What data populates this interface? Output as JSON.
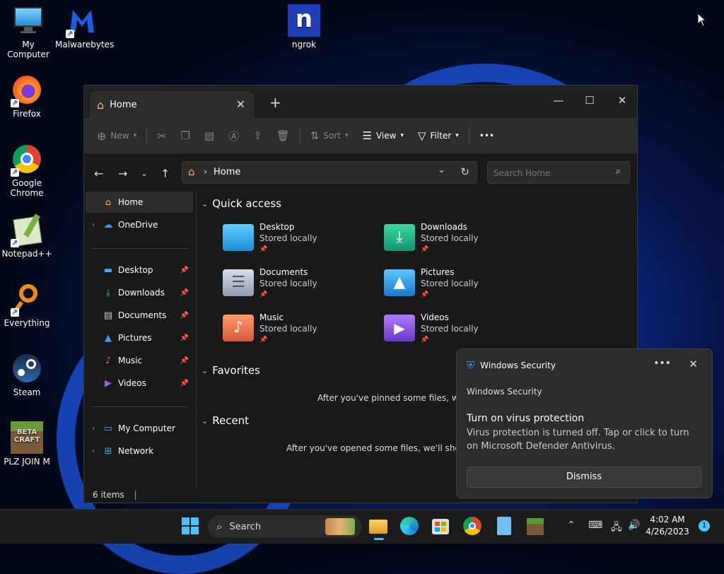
{
  "desktop": {
    "icons": [
      {
        "label": "My Computer",
        "icon": "monitor-icon"
      },
      {
        "label": "Malwarebytes",
        "icon": "malwarebytes-icon"
      },
      {
        "label": "ngrok",
        "icon": "ngrok-icon"
      },
      {
        "label": "Firefox",
        "icon": "firefox-icon"
      },
      {
        "label": "Google Chrome",
        "icon": "chrome-icon"
      },
      {
        "label": "Notepad++",
        "icon": "notepadpp-icon"
      },
      {
        "label": "Everything",
        "icon": "everything-icon"
      },
      {
        "label": "Steam",
        "icon": "steam-icon"
      },
      {
        "label": "PLZ JOIN M",
        "icon": "betacraft-icon"
      }
    ],
    "ngrok_glyph": "n",
    "betacraft_text": "BETA CRAFT"
  },
  "explorer": {
    "tab_title": "Home",
    "new_tab": "+",
    "toolbar": {
      "new": "New",
      "sort": "Sort",
      "view": "View",
      "filter": "Filter",
      "more": "•••"
    },
    "address": {
      "path": "Home"
    },
    "search": {
      "placeholder": "Search Home"
    },
    "sidebar": {
      "home": "Home",
      "onedrive": "OneDrive",
      "pinned": [
        "Desktop",
        "Downloads",
        "Documents",
        "Pictures",
        "Music",
        "Videos"
      ],
      "mycomputer": "My Computer",
      "network": "Network"
    },
    "sections": {
      "quick_access": "Quick access",
      "favorites": "Favorites",
      "recent": "Recent"
    },
    "quick_access_items": [
      {
        "name": "Desktop",
        "sub": "Stored locally"
      },
      {
        "name": "Downloads",
        "sub": "Stored locally"
      },
      {
        "name": "Documents",
        "sub": "Stored locally"
      },
      {
        "name": "Pictures",
        "sub": "Stored locally"
      },
      {
        "name": "Music",
        "sub": "Stored locally"
      },
      {
        "name": "Videos",
        "sub": "Stored locally"
      }
    ],
    "favorites_empty": "After you've pinned some files, we'll s",
    "recent_empty": "After you've opened some files, we'll show th",
    "status": "6 items"
  },
  "toast": {
    "header": "Windows Security",
    "app": "Windows Security",
    "title": "Turn on virus protection",
    "body": "Virus protection is turned off. Tap or click to turn on Microsoft Defender Antivirus.",
    "button": "Dismiss",
    "more": "•••"
  },
  "taskbar": {
    "search_label": "Search",
    "time": "4:02 AM",
    "date": "4/26/2023",
    "notification_count": "1"
  },
  "colors": {
    "accent": "#4cc2ff",
    "folder_blue": "#2aa3e8",
    "downloads_green": "#1aa37a",
    "music_orange": "#e8704a",
    "videos_purple": "#8a4ee0"
  }
}
